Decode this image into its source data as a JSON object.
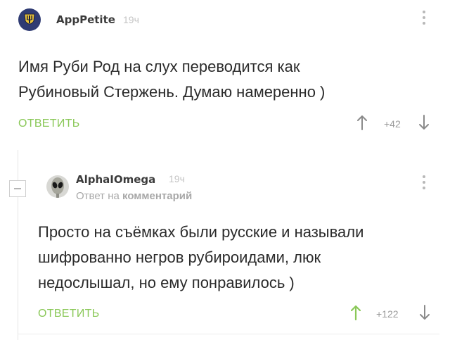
{
  "comments": [
    {
      "username": "AppPetite",
      "time": "19ч",
      "text_lines": [
        "Имя Руби Род на слух переводится как",
        "Рубиновый Стержень. Думаю намеренно )"
      ],
      "reply_label": "ОТВЕТИТЬ",
      "rating": "+42"
    },
    {
      "username": "AlphaIOmega",
      "time": "19ч",
      "reply_to_prefix": "Ответ на",
      "reply_to_link": "комментарий",
      "text_lines": [
        "Просто на съёмках были русские и называли",
        "шифрованно негров рубироидами, люк",
        "недослышал, но ему понравилось )"
      ],
      "reply_label": "ОТВЕТИТЬ",
      "rating": "+122"
    }
  ],
  "icons": {
    "avatar_1": "shield-fork-avatar",
    "avatar_2": "alien-avatar",
    "more": "vertical-dots-icon",
    "upvote": "arrow-up-icon",
    "downvote": "arrow-down-icon",
    "collapse": "minus-box-icon"
  },
  "colors": {
    "accent": "#8ac858",
    "muted": "#9a9a9a",
    "text": "#2b2b2b"
  }
}
